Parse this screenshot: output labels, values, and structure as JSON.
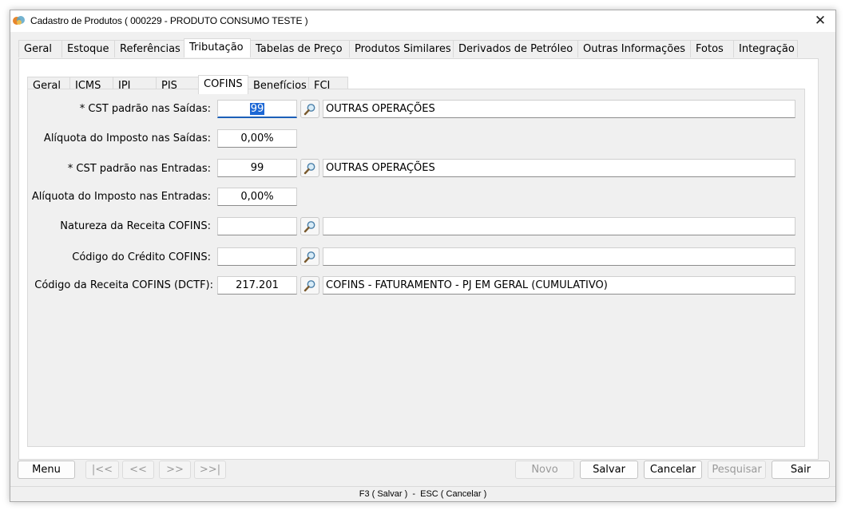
{
  "window": {
    "title": "Cadastro de Produtos ( 000229 - PRODUTO CONSUMO TESTE )"
  },
  "main_tabs": [
    {
      "label": "Geral"
    },
    {
      "label": "Estoque"
    },
    {
      "label": "Referências"
    },
    {
      "label": "Tributação"
    },
    {
      "label": "Tabelas de Preço"
    },
    {
      "label": "Produtos Similares"
    },
    {
      "label": "Derivados de Petróleo"
    },
    {
      "label": "Outras Informações"
    },
    {
      "label": "Fotos"
    },
    {
      "label": "Integração"
    }
  ],
  "sub_tabs": [
    {
      "label": "Geral"
    },
    {
      "label": "ICMS"
    },
    {
      "label": "IPI"
    },
    {
      "label": "PIS"
    },
    {
      "label": "COFINS"
    },
    {
      "label": "Benefícios"
    },
    {
      "label": "FCI"
    }
  ],
  "active_main_tab": "Tributação",
  "active_sub_tab": "COFINS",
  "form": {
    "cst_saidas": {
      "label": "* CST padrão nas Saídas:",
      "code": "99",
      "description": "OUTRAS OPERAÇÕES"
    },
    "aliq_saidas": {
      "label": "Alíquota do Imposto nas Saídas:",
      "value": "0,00%"
    },
    "cst_entradas": {
      "label": "* CST padrão nas Entradas:",
      "code": "99",
      "description": "OUTRAS OPERAÇÕES"
    },
    "aliq_entradas": {
      "label": "Alíquota do Imposto nas Entradas:",
      "value": "0,00%"
    },
    "natureza": {
      "label": "Natureza da Receita COFINS:",
      "code": "",
      "description": ""
    },
    "credito": {
      "label": "Código do Crédito COFINS:",
      "code": "",
      "description": ""
    },
    "receita_dctf": {
      "label": "Código da Receita COFINS (DCTF):",
      "code": "217.201",
      "description": "COFINS - FATURAMENTO - PJ EM GERAL (CUMULATIVO)"
    }
  },
  "buttons": {
    "menu": "Menu",
    "first": "|<<",
    "prev": "<<",
    "next": ">>",
    "last": ">>|",
    "novo": "Novo",
    "salvar": "Salvar",
    "cancelar": "Cancelar",
    "pesquisar": "Pesquisar",
    "sair": "Sair"
  },
  "status": "F3 ( Salvar )  -  ESC ( Cancelar )",
  "icons": {
    "search": "magnifier-icon",
    "close": "close-icon",
    "app": "app-icon"
  },
  "colors": {
    "selection": "#1c67d5",
    "focus_underline": "#1b5fb8"
  }
}
